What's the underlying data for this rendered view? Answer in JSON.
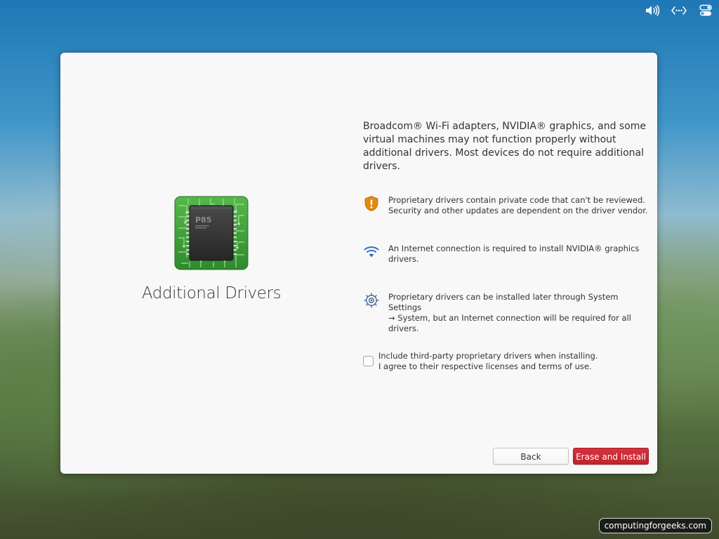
{
  "panel": {
    "indicators": [
      {
        "icon": "volume-icon"
      },
      {
        "icon": "network-icon"
      },
      {
        "icon": "session-toggles-icon"
      }
    ]
  },
  "installer": {
    "title": "Additional Drivers",
    "chip_label": "P85",
    "intro": "Broadcom® Wi-Fi adapters, NVIDIA® graphics, and some virtual machines may not function properly without additional drivers. Most devices do not require additional drivers.",
    "notes": [
      {
        "icon": "security-warning-icon",
        "line1": "Proprietary drivers contain private code that can't be reviewed.",
        "line2": "Security and other updates are dependent on the driver vendor."
      },
      {
        "icon": "wifi-icon",
        "line1": "An Internet connection is required to install NVIDIA® graphics",
        "line2": "drivers."
      },
      {
        "icon": "settings-gear-icon",
        "line1": "Proprietary drivers can be installed later through System Settings",
        "line2": "→ System, but an Internet connection will be required for all",
        "line3": "drivers."
      }
    ],
    "checkbox": {
      "checked": false,
      "line1": "Include third-party proprietary drivers when installing.",
      "line2": "I agree to their respective licenses and terms of use."
    },
    "buttons": {
      "back": "Back",
      "install": "Erase and Install"
    }
  },
  "watermark": "computingforgeeks.com",
  "colors": {
    "accent_red": "#c1232d",
    "shield": "#e08a14",
    "wifi": "#2b74c7",
    "chip_green": "#3e9a3a"
  }
}
